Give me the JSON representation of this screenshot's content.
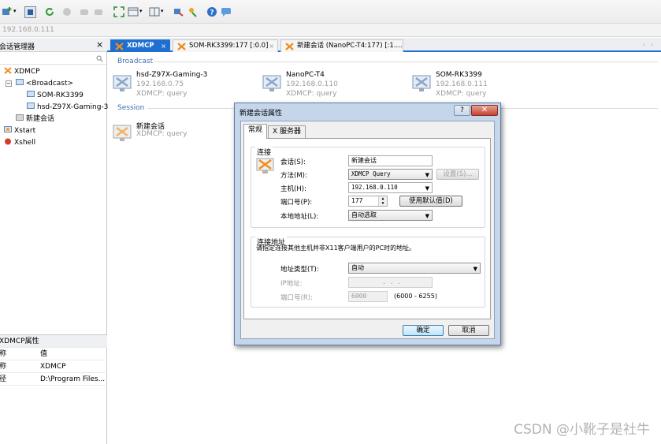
{
  "address": {
    "text": "192.168.0.111"
  },
  "sidebar": {
    "title": "会话管理器",
    "close": "×",
    "tree": [
      {
        "label": "XDMCP"
      },
      {
        "label": "<Broadcast>"
      },
      {
        "label": "SOM-RK3399"
      },
      {
        "label": "hsd-Z97X-Gaming-3"
      },
      {
        "label": "新建会话"
      },
      {
        "label": "Xstart"
      },
      {
        "label": "Xshell"
      }
    ],
    "props": {
      "title": "XDMCP属性",
      "col_name": "称",
      "col_value": "值",
      "rows": [
        {
          "name": "称",
          "value": "XDMCP"
        },
        {
          "name": "径",
          "value": "D:\\Program Files..."
        }
      ]
    }
  },
  "tabs": [
    {
      "label": "XDMCP"
    },
    {
      "label": "SOM-RK3399:177 [:0.0]"
    },
    {
      "label": "新建会话 (NanoPC-T4:177) [:1...."
    }
  ],
  "tab_close": "×",
  "content": {
    "broadcast_title": "Broadcast",
    "session_title": "Session",
    "hosts": [
      {
        "name": "hsd-Z97X-Gaming-3",
        "ip": "192.168.0.75",
        "proto": "XDMCP: query"
      },
      {
        "name": "NanoPC-T4",
        "ip": "192.168.0.110",
        "proto": "XDMCP: query"
      },
      {
        "name": "SOM-RK3399",
        "ip": "192.168.0.111",
        "proto": "XDMCP: query"
      }
    ],
    "session": {
      "name": "新建会话",
      "proto": "XDMCP: query"
    }
  },
  "dialog": {
    "title": "新建会话属性",
    "help": "?",
    "close": "✕",
    "tabs": [
      "常规",
      "X 服务器"
    ],
    "conn_group": "连接",
    "session_label": "会话(S):",
    "session_value": "新建会话",
    "method_label": "方法(M):",
    "method_value": "XDMCP Query",
    "settings_btn": "设置(S)...",
    "host_label": "主机(H):",
    "host_value": "192.168.0.110",
    "port_label": "端口号(P):",
    "port_value": "177",
    "default_btn": "使用默认值(D)",
    "local_addr_label": "本地地址(L):",
    "local_addr_value": "自动选取",
    "addr_group": "连接地址",
    "addr_desc": "请指定连接其他主机并非X11客户端用户的PC时的地址。",
    "addr_type_label": "地址类型(T):",
    "addr_type_value": "自动",
    "ip_label": "IP地址:",
    "ip_value": ".   .   .",
    "port2_label": "端口号(R):",
    "port2_value": "6000",
    "port_range": "(6000 - 6255)",
    "ok": "确定",
    "cancel": "取消"
  },
  "watermark": "CSDN @小靴子是社牛",
  "colors": {
    "accent": "#1f6fd1",
    "xlogo": "#f08c1a",
    "dialog_frame": "#c5d6ea"
  }
}
